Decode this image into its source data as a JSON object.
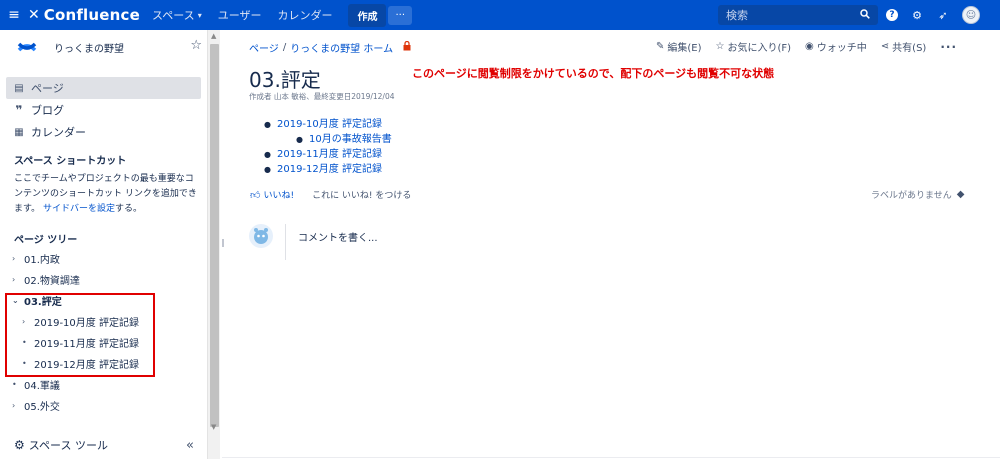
{
  "topnav": {
    "brand": "Confluence",
    "spaces": "スペース",
    "users": "ユーザー",
    "calendar": "カレンダー",
    "create": "作成",
    "more": "···",
    "search_placeholder": "検索",
    "icons": [
      "menu-icon",
      "confluence-logo-icon",
      "chevron-down-icon",
      "search-icon",
      "help-icon",
      "gear-icon",
      "notification-icon",
      "avatar"
    ]
  },
  "sidebar": {
    "space_name": "りっくまの野望",
    "nav": [
      {
        "label": "ページ",
        "icon": "page-icon",
        "active": true
      },
      {
        "label": "ブログ",
        "icon": "quote-icon",
        "active": false
      },
      {
        "label": "カレンダー",
        "icon": "calendar-icon",
        "active": false
      }
    ],
    "shortcuts_title": "スペース ショートカット",
    "shortcuts_text_1": "ここでチームやプロジェクトの最も重要なコンテンツのショートカット リンクを追加できます。",
    "shortcuts_link": "サイドバーを設定",
    "shortcuts_text_2": "する。",
    "tree_title": "ページ ツリー",
    "tree": [
      {
        "label": "01.内政",
        "toggle": "›",
        "level": 0,
        "bold": false
      },
      {
        "label": "02.物資調達",
        "toggle": "›",
        "level": 0,
        "bold": false
      },
      {
        "label": "03.評定",
        "toggle": "⌄",
        "level": 0,
        "bold": true
      },
      {
        "label": "2019-10月度 評定記録",
        "toggle": "›",
        "level": 1,
        "bold": false
      },
      {
        "label": "2019-11月度 評定記録",
        "toggle": "•",
        "level": 1,
        "bold": false
      },
      {
        "label": "2019-12月度 評定記録",
        "toggle": "•",
        "level": 1,
        "bold": false
      },
      {
        "label": "04.軍議",
        "toggle": "•",
        "level": 0,
        "bold": false
      },
      {
        "label": "05.外交",
        "toggle": "›",
        "level": 0,
        "bold": false
      }
    ],
    "space_tools": "スペース ツール",
    "collapse": "«"
  },
  "page": {
    "breadcrumb": [
      "ページ",
      "りっくまの野望 ホーム"
    ],
    "breadcrumb_sep": "/",
    "actions": {
      "edit": "編集(E)",
      "favorite": "お気に入り(F)",
      "watching": "ウォッチ中",
      "share": "共有(S)",
      "more": "···"
    },
    "title": "03.評定",
    "annotation": "このページに閲覧制限をかけているので、配下のページも閲覧不可な状態",
    "byline": "作成者 山本 敏裕、最終変更日2019/12/04",
    "children": [
      {
        "label": "2019-10月度 評定記録",
        "level": 0
      },
      {
        "label": "10月の事故報告書",
        "level": 1
      },
      {
        "label": "2019-11月度 評定記録",
        "level": 0
      },
      {
        "label": "2019-12月度 評定記録",
        "level": 0
      }
    ],
    "like": "いいね!",
    "like_first": "これに いいね! をつける",
    "no_labels": "ラベルがありません",
    "comment_placeholder": "コメントを書く..."
  },
  "colors": {
    "nav_bg": "#0052cc",
    "link": "#0052cc",
    "annotation": "#e00000",
    "lock": "#de350b"
  }
}
